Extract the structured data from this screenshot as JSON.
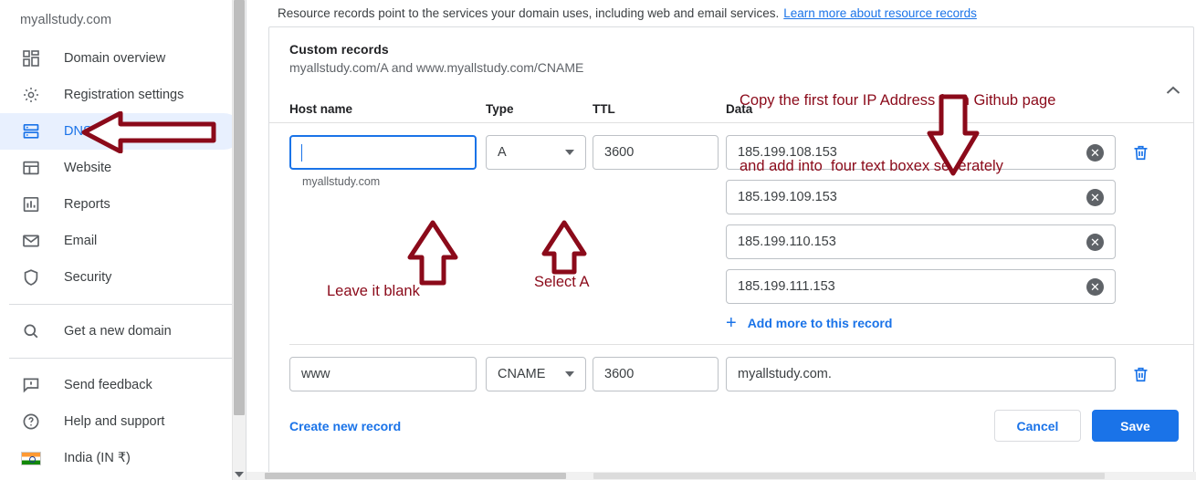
{
  "sidebar": {
    "domain": "myallstudy.com",
    "items": [
      {
        "label": "Domain overview",
        "icon": "dashboard-icon",
        "active": false
      },
      {
        "label": "Registration settings",
        "icon": "gear-icon",
        "active": false
      },
      {
        "label": "DNS",
        "icon": "dns-server-icon",
        "active": true
      },
      {
        "label": "Website",
        "icon": "website-icon",
        "active": false
      },
      {
        "label": "Reports",
        "icon": "chart-bar-icon",
        "active": false
      },
      {
        "label": "Email",
        "icon": "envelope-icon",
        "active": false
      },
      {
        "label": "Security",
        "icon": "shield-icon",
        "active": false
      }
    ],
    "get_domain": {
      "label": "Get a new domain",
      "icon": "search-icon"
    },
    "footer_items": [
      {
        "label": "Send feedback",
        "icon": "feedback-icon"
      },
      {
        "label": "Help and support",
        "icon": "help-circle-icon"
      },
      {
        "label": "India (IN ₹)",
        "icon": "india-flag-icon"
      }
    ]
  },
  "banner": {
    "text": "Resource records point to the services your domain uses, including web and email services.",
    "link": "Learn more about resource records"
  },
  "card": {
    "title": "Custom records",
    "subtitle": "myallstudy.com/A and www.myallstudy.com/CNAME",
    "collapse_icon": "chevron-up-icon"
  },
  "table": {
    "headers": {
      "host": "Host name",
      "type": "Type",
      "ttl": "TTL",
      "data": "Data"
    }
  },
  "record_a": {
    "host_value": "",
    "host_helper": "myallstudy.com",
    "type_value": "A",
    "ttl_value": "3600",
    "data_values": [
      "185.199.108.153",
      "185.199.109.153",
      "185.199.110.153",
      "185.199.111.153"
    ],
    "clear_icon": "clear-circle-icon",
    "delete_icon": "trash-icon",
    "add_more_label": "Add more to this record",
    "add_more_icon": "plus-icon"
  },
  "record_cname": {
    "host_value": "www",
    "type_value": "CNAME",
    "ttl_value": "3600",
    "data_value": "myallstudy.com.",
    "delete_icon": "trash-icon"
  },
  "footer": {
    "create_label": "Create new record",
    "cancel_label": "Cancel",
    "save_label": "Save"
  },
  "annotations": {
    "copy_ips_line1": "Copy the first four IP Address from Github page",
    "copy_ips_line2": "and add into  four text boxex seperately",
    "leave_blank": "Leave it blank",
    "select_a": "Select A"
  },
  "colors": {
    "accent_blue": "#1a73e8",
    "active_bg": "#e8f0fe",
    "annotation_red": "#8b0a1a",
    "text_primary": "#202124",
    "text_secondary": "#5f6368",
    "border": "#dadce0"
  }
}
